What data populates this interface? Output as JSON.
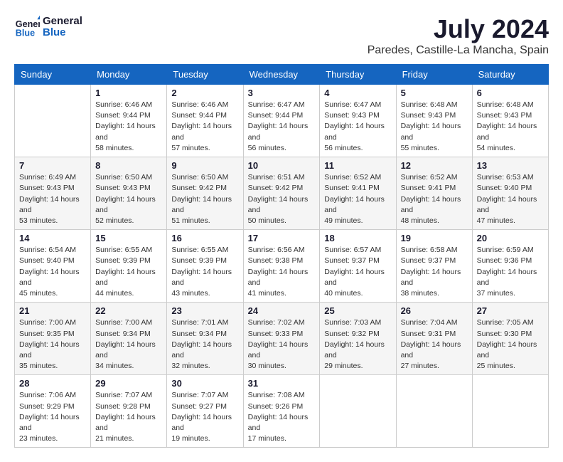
{
  "header": {
    "logo_line1": "General",
    "logo_line2": "Blue",
    "month_title": "July 2024",
    "location": "Paredes, Castille-La Mancha, Spain"
  },
  "weekdays": [
    "Sunday",
    "Monday",
    "Tuesday",
    "Wednesday",
    "Thursday",
    "Friday",
    "Saturday"
  ],
  "weeks": [
    [
      {
        "day": "",
        "sunrise": "",
        "sunset": "",
        "daylight": ""
      },
      {
        "day": "1",
        "sunrise": "Sunrise: 6:46 AM",
        "sunset": "Sunset: 9:44 PM",
        "daylight": "Daylight: 14 hours and 58 minutes."
      },
      {
        "day": "2",
        "sunrise": "Sunrise: 6:46 AM",
        "sunset": "Sunset: 9:44 PM",
        "daylight": "Daylight: 14 hours and 57 minutes."
      },
      {
        "day": "3",
        "sunrise": "Sunrise: 6:47 AM",
        "sunset": "Sunset: 9:44 PM",
        "daylight": "Daylight: 14 hours and 56 minutes."
      },
      {
        "day": "4",
        "sunrise": "Sunrise: 6:47 AM",
        "sunset": "Sunset: 9:43 PM",
        "daylight": "Daylight: 14 hours and 56 minutes."
      },
      {
        "day": "5",
        "sunrise": "Sunrise: 6:48 AM",
        "sunset": "Sunset: 9:43 PM",
        "daylight": "Daylight: 14 hours and 55 minutes."
      },
      {
        "day": "6",
        "sunrise": "Sunrise: 6:48 AM",
        "sunset": "Sunset: 9:43 PM",
        "daylight": "Daylight: 14 hours and 54 minutes."
      }
    ],
    [
      {
        "day": "7",
        "sunrise": "Sunrise: 6:49 AM",
        "sunset": "Sunset: 9:43 PM",
        "daylight": "Daylight: 14 hours and 53 minutes."
      },
      {
        "day": "8",
        "sunrise": "Sunrise: 6:50 AM",
        "sunset": "Sunset: 9:43 PM",
        "daylight": "Daylight: 14 hours and 52 minutes."
      },
      {
        "day": "9",
        "sunrise": "Sunrise: 6:50 AM",
        "sunset": "Sunset: 9:42 PM",
        "daylight": "Daylight: 14 hours and 51 minutes."
      },
      {
        "day": "10",
        "sunrise": "Sunrise: 6:51 AM",
        "sunset": "Sunset: 9:42 PM",
        "daylight": "Daylight: 14 hours and 50 minutes."
      },
      {
        "day": "11",
        "sunrise": "Sunrise: 6:52 AM",
        "sunset": "Sunset: 9:41 PM",
        "daylight": "Daylight: 14 hours and 49 minutes."
      },
      {
        "day": "12",
        "sunrise": "Sunrise: 6:52 AM",
        "sunset": "Sunset: 9:41 PM",
        "daylight": "Daylight: 14 hours and 48 minutes."
      },
      {
        "day": "13",
        "sunrise": "Sunrise: 6:53 AM",
        "sunset": "Sunset: 9:40 PM",
        "daylight": "Daylight: 14 hours and 47 minutes."
      }
    ],
    [
      {
        "day": "14",
        "sunrise": "Sunrise: 6:54 AM",
        "sunset": "Sunset: 9:40 PM",
        "daylight": "Daylight: 14 hours and 45 minutes."
      },
      {
        "day": "15",
        "sunrise": "Sunrise: 6:55 AM",
        "sunset": "Sunset: 9:39 PM",
        "daylight": "Daylight: 14 hours and 44 minutes."
      },
      {
        "day": "16",
        "sunrise": "Sunrise: 6:55 AM",
        "sunset": "Sunset: 9:39 PM",
        "daylight": "Daylight: 14 hours and 43 minutes."
      },
      {
        "day": "17",
        "sunrise": "Sunrise: 6:56 AM",
        "sunset": "Sunset: 9:38 PM",
        "daylight": "Daylight: 14 hours and 41 minutes."
      },
      {
        "day": "18",
        "sunrise": "Sunrise: 6:57 AM",
        "sunset": "Sunset: 9:37 PM",
        "daylight": "Daylight: 14 hours and 40 minutes."
      },
      {
        "day": "19",
        "sunrise": "Sunrise: 6:58 AM",
        "sunset": "Sunset: 9:37 PM",
        "daylight": "Daylight: 14 hours and 38 minutes."
      },
      {
        "day": "20",
        "sunrise": "Sunrise: 6:59 AM",
        "sunset": "Sunset: 9:36 PM",
        "daylight": "Daylight: 14 hours and 37 minutes."
      }
    ],
    [
      {
        "day": "21",
        "sunrise": "Sunrise: 7:00 AM",
        "sunset": "Sunset: 9:35 PM",
        "daylight": "Daylight: 14 hours and 35 minutes."
      },
      {
        "day": "22",
        "sunrise": "Sunrise: 7:00 AM",
        "sunset": "Sunset: 9:34 PM",
        "daylight": "Daylight: 14 hours and 34 minutes."
      },
      {
        "day": "23",
        "sunrise": "Sunrise: 7:01 AM",
        "sunset": "Sunset: 9:34 PM",
        "daylight": "Daylight: 14 hours and 32 minutes."
      },
      {
        "day": "24",
        "sunrise": "Sunrise: 7:02 AM",
        "sunset": "Sunset: 9:33 PM",
        "daylight": "Daylight: 14 hours and 30 minutes."
      },
      {
        "day": "25",
        "sunrise": "Sunrise: 7:03 AM",
        "sunset": "Sunset: 9:32 PM",
        "daylight": "Daylight: 14 hours and 29 minutes."
      },
      {
        "day": "26",
        "sunrise": "Sunrise: 7:04 AM",
        "sunset": "Sunset: 9:31 PM",
        "daylight": "Daylight: 14 hours and 27 minutes."
      },
      {
        "day": "27",
        "sunrise": "Sunrise: 7:05 AM",
        "sunset": "Sunset: 9:30 PM",
        "daylight": "Daylight: 14 hours and 25 minutes."
      }
    ],
    [
      {
        "day": "28",
        "sunrise": "Sunrise: 7:06 AM",
        "sunset": "Sunset: 9:29 PM",
        "daylight": "Daylight: 14 hours and 23 minutes."
      },
      {
        "day": "29",
        "sunrise": "Sunrise: 7:07 AM",
        "sunset": "Sunset: 9:28 PM",
        "daylight": "Daylight: 14 hours and 21 minutes."
      },
      {
        "day": "30",
        "sunrise": "Sunrise: 7:07 AM",
        "sunset": "Sunset: 9:27 PM",
        "daylight": "Daylight: 14 hours and 19 minutes."
      },
      {
        "day": "31",
        "sunrise": "Sunrise: 7:08 AM",
        "sunset": "Sunset: 9:26 PM",
        "daylight": "Daylight: 14 hours and 17 minutes."
      },
      {
        "day": "",
        "sunrise": "",
        "sunset": "",
        "daylight": ""
      },
      {
        "day": "",
        "sunrise": "",
        "sunset": "",
        "daylight": ""
      },
      {
        "day": "",
        "sunrise": "",
        "sunset": "",
        "daylight": ""
      }
    ]
  ]
}
